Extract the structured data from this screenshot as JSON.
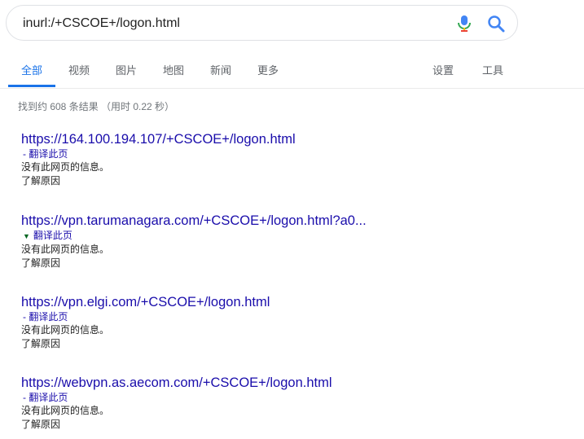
{
  "search": {
    "query": "inurl:/+CSCOE+/logon.html"
  },
  "tabs": [
    {
      "label": "全部"
    },
    {
      "label": "视频"
    },
    {
      "label": "图片"
    },
    {
      "label": "地图"
    },
    {
      "label": "新闻"
    },
    {
      "label": "更多"
    },
    {
      "label": "设置"
    },
    {
      "label": "工具"
    }
  ],
  "stats": "找到约 608 条结果 （用时 0.22 秒）",
  "results": [
    {
      "url": "https://164.100.194.107/+CSCOE+/logon.html",
      "translate": "- 翻译此页",
      "desc": "没有此网页的信息。",
      "learn": "了解原因"
    },
    {
      "url": "https://vpn.tarumanagara.com/+CSCOE+/logon.html?a0...",
      "translate": "翻译此页",
      "desc": "没有此网页的信息。",
      "learn": "了解原因"
    },
    {
      "url": "https://vpn.elgi.com/+CSCOE+/logon.html",
      "translate": "- 翻译此页",
      "desc": "没有此网页的信息。",
      "learn": "了解原因"
    },
    {
      "url": "https://webvpn.as.aecom.com/+CSCOE+/logon.html",
      "translate": "- 翻译此页",
      "desc": "没有此网页的信息。",
      "learn": "了解原因"
    }
  ],
  "icons": {
    "mic": "microphone-icon",
    "search": "search-icon",
    "dropdown": "triangle-down-icon"
  },
  "colors": {
    "accent": "#1a73e8",
    "link": "#1a0dab",
    "muted": "#70757a",
    "dropdown": "#006621"
  }
}
